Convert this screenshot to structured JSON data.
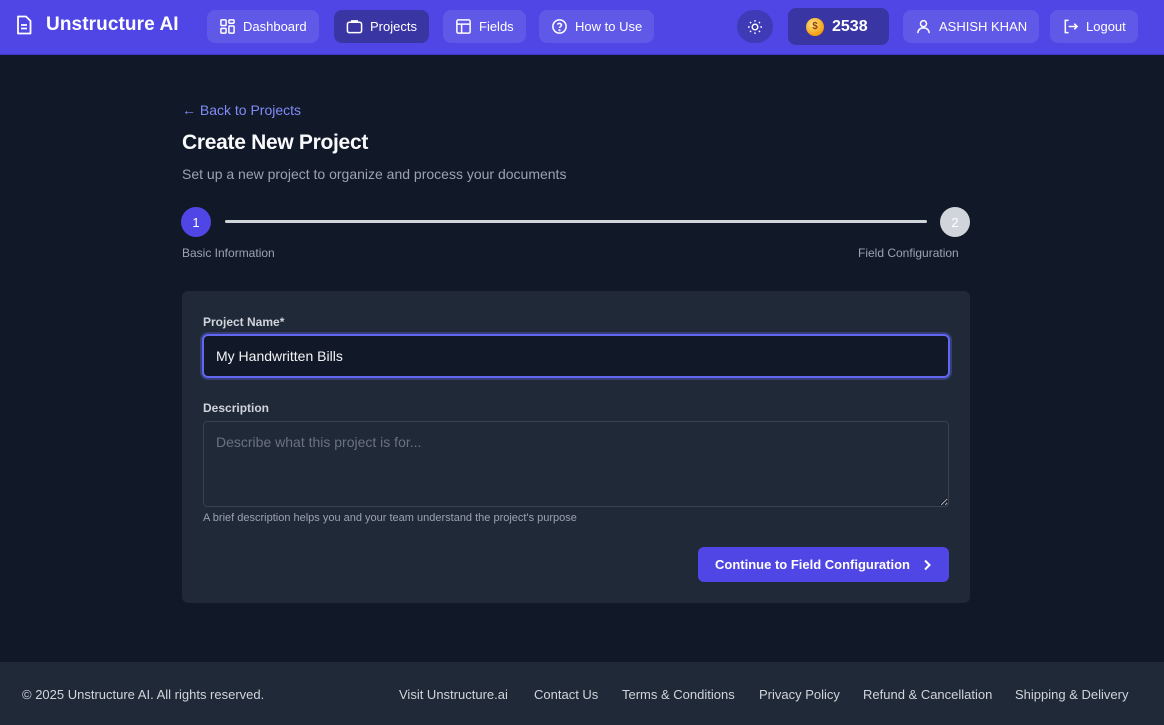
{
  "header": {
    "brand": "Unstructure AI",
    "nav": [
      {
        "label": "Dashboard",
        "icon": "grid-icon"
      },
      {
        "label": "Projects",
        "icon": "briefcase-icon",
        "active": true
      },
      {
        "label": "Fields",
        "icon": "table-icon"
      },
      {
        "label": "How to Use",
        "icon": "help-circle-icon"
      }
    ],
    "credits": "2538",
    "user": "ASHISH KHAN",
    "logout": "Logout"
  },
  "main": {
    "back_link": "← Back to Projects",
    "title": "Create New Project",
    "subtitle": "Set up a new project to organize and process your documents",
    "steps": [
      {
        "number": "1",
        "label": "Basic Information",
        "active": true
      },
      {
        "number": "2",
        "label": "Field Configuration",
        "active": false
      }
    ],
    "form": {
      "name_label": "Project Name*",
      "name_value": "My Handwritten Bills",
      "desc_label": "Description",
      "desc_placeholder": "Describe what this project is for...",
      "hint": "A brief description helps you and your team understand the project's purpose",
      "continue_label": "Continue to Field Configuration"
    }
  },
  "footer": {
    "copyright": "© 2025 Unstructure AI. All rights reserved.",
    "links": [
      "Visit Unstructure.ai",
      "Contact Us",
      "Terms & Conditions",
      "Privacy Policy",
      "Refund & Cancellation",
      "Shipping & Delivery"
    ]
  },
  "colors": {
    "accent": "#4f46e5",
    "background": "#111827",
    "card": "#1f2937"
  }
}
